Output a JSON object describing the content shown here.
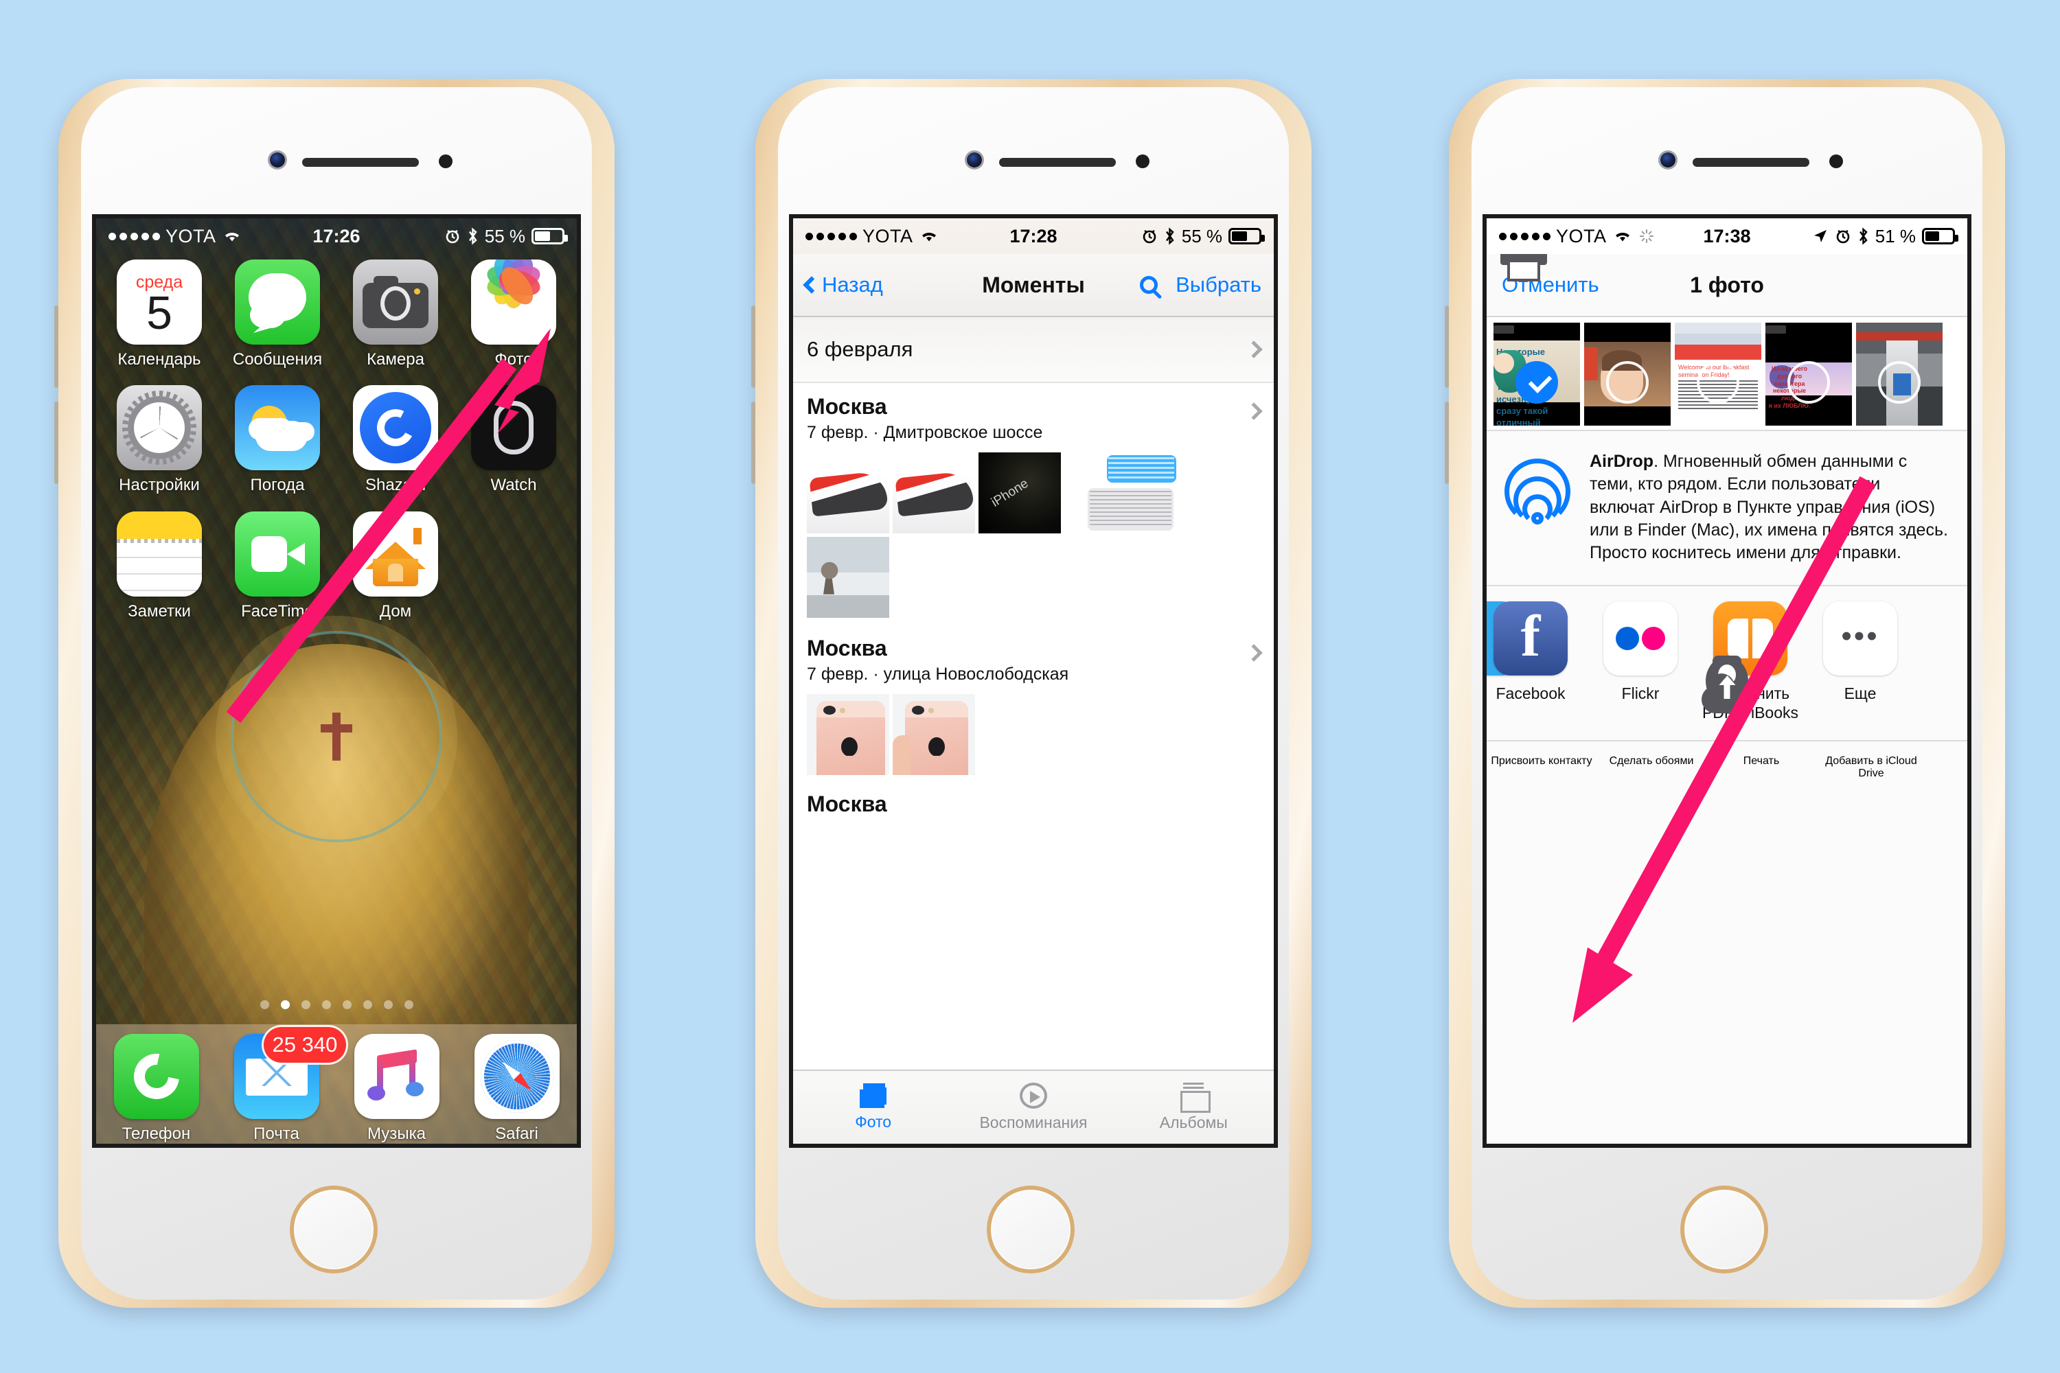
{
  "background_color": "#b9dcf7",
  "accent_blue": "#0a7cff",
  "arrow_color": "#f8156b",
  "phones": [
    {
      "id": "home-screen",
      "status_bar": {
        "signal_dots": 5,
        "carrier": "YOTA",
        "wifi": "wifi-icon",
        "time": "17:26",
        "alarm": "alarm-icon",
        "bluetooth": "bluetooth-icon",
        "battery_percent": "55 %",
        "battery_level": 55
      },
      "home": {
        "rows": [
          [
            {
              "name": "Календарь",
              "icon": "calendar-icon",
              "weekday": "среда",
              "day": "5"
            },
            {
              "name": "Сообщения",
              "icon": "messages-icon"
            },
            {
              "name": "Камера",
              "icon": "camera-icon"
            },
            {
              "name": "Фото",
              "icon": "photos-icon"
            }
          ],
          [
            {
              "name": "Настройки",
              "icon": "settings-icon"
            },
            {
              "name": "Погода",
              "icon": "weather-icon"
            },
            {
              "name": "Shazam",
              "icon": "shazam-icon"
            },
            {
              "name": "Watch",
              "icon": "watch-icon"
            }
          ],
          [
            {
              "name": "Заметки",
              "icon": "notes-icon"
            },
            {
              "name": "FaceTime",
              "icon": "facetime-icon"
            },
            {
              "name": "Дом",
              "icon": "home-app-icon"
            }
          ]
        ],
        "page_dots": 8,
        "active_page": 2,
        "dock": [
          {
            "name": "Телефон",
            "icon": "phone-icon"
          },
          {
            "name": "Почта",
            "icon": "mail-icon",
            "badge": "25 340"
          },
          {
            "name": "Музыка",
            "icon": "music-icon"
          },
          {
            "name": "Safari",
            "icon": "safari-icon"
          }
        ]
      }
    },
    {
      "id": "photos-moments",
      "status_bar": {
        "signal_dots": 5,
        "carrier": "YOTA",
        "wifi": "wifi-icon",
        "time": "17:28",
        "alarm": "alarm-icon",
        "bluetooth": "bluetooth-icon",
        "battery_percent": "55 %",
        "battery_level": 55
      },
      "nav": {
        "back_label": "Назад",
        "title": "Моменты",
        "search_icon": "search-icon",
        "action_label": "Выбрать"
      },
      "date_header": "6 февраля",
      "moments": [
        {
          "city": "Москва",
          "subtitle": "7 февр. · Дмитровское шоссе"
        },
        {
          "city": "Москва",
          "subtitle": "7 февр. · улица Новослободская"
        },
        {
          "city": "Москва",
          "subtitle": ""
        }
      ],
      "tabs": [
        {
          "label": "Фото",
          "icon": "photos-stack-icon",
          "active": true
        },
        {
          "label": "Воспоминания",
          "icon": "memories-icon",
          "active": false
        },
        {
          "label": "Альбомы",
          "icon": "albums-icon",
          "active": false
        }
      ]
    },
    {
      "id": "share-sheet",
      "status_bar": {
        "signal_dots": 5,
        "carrier": "YOTA",
        "wifi": "wifi-icon",
        "sync": "sync-icon",
        "time": "17:38",
        "location": "location-arrow-icon",
        "alarm": "alarm-icon",
        "bluetooth": "bluetooth-icon",
        "battery_percent": "51 %",
        "battery_level": 51
      },
      "nav": {
        "cancel_label": "Отменить",
        "title": "1 фото"
      },
      "thumbnails_selected": 1,
      "airdrop": {
        "icon": "airdrop-icon",
        "title": "AirDrop",
        "text": ". Мгновенный обмен данными с теми, кто рядом. Если пользователи включат AirDrop в Пункте управления (iOS) или в Finder (Mac), их имена появятся здесь. Просто коснитесь имени для отправки."
      },
      "share_apps": [
        {
          "label": "",
          "icon": "message-blue-icon"
        },
        {
          "label": "Facebook",
          "icon": "facebook-icon"
        },
        {
          "label": "Flickr",
          "icon": "flickr-icon"
        },
        {
          "label": "Сохранить PDF в iBooks",
          "icon": "ibooks-icon"
        },
        {
          "label": "Еще",
          "icon": "more-dots-icon"
        }
      ],
      "actions": [
        {
          "label": "Присвоить контакту",
          "icon": "contact-icon"
        },
        {
          "label": "Сделать обоями",
          "icon": "wallpaper-icon"
        },
        {
          "label": "Печать",
          "icon": "print-icon"
        },
        {
          "label": "Добавить в iCloud Drive",
          "icon": "icloud-upload-icon"
        }
      ]
    }
  ]
}
